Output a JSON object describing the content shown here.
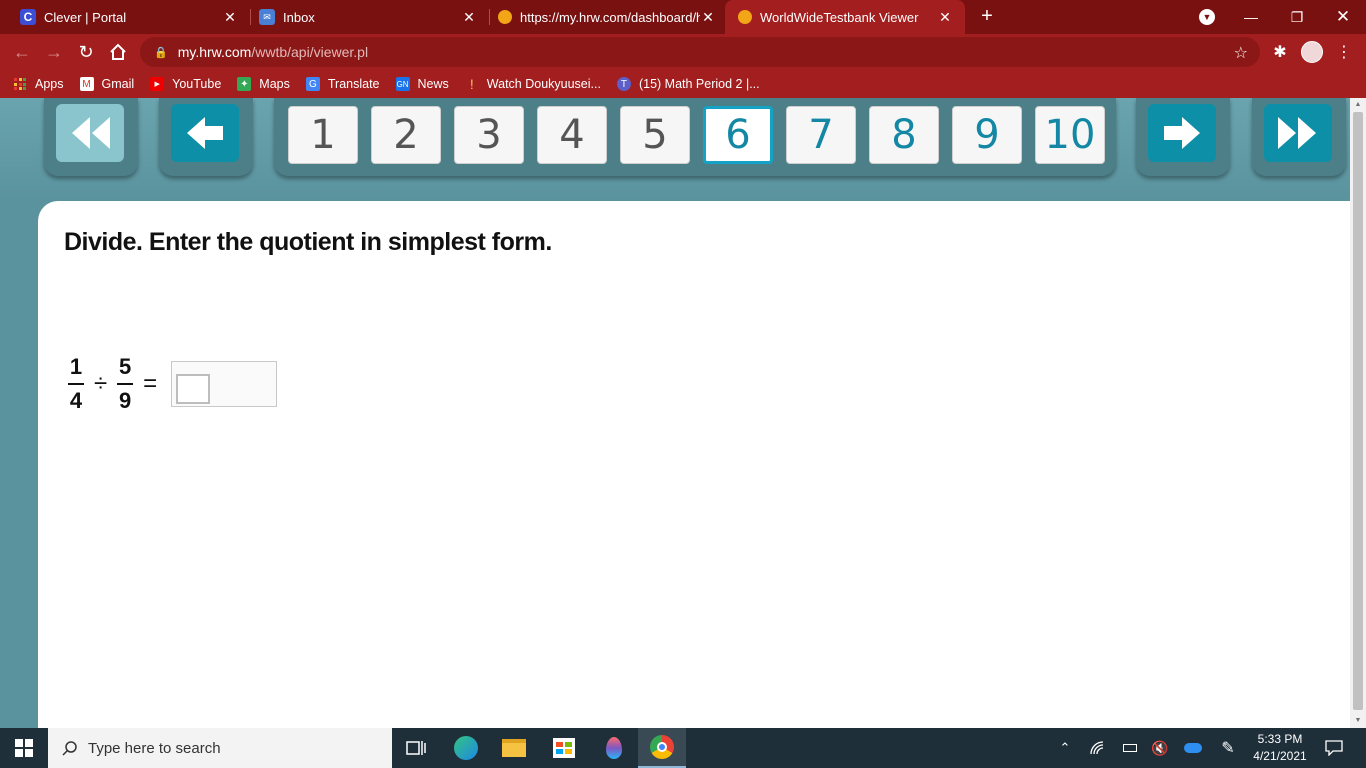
{
  "browser": {
    "tabs": [
      {
        "title": "Clever | Portal",
        "favicon": "clever-icon"
      },
      {
        "title": "Inbox",
        "favicon": "inbox-icon"
      },
      {
        "title": "https://my.hrw.com/dashboard/h",
        "favicon": "hrw-icon"
      },
      {
        "title": "WorldWideTestbank Viewer",
        "favicon": "hrw-icon",
        "active": true
      }
    ],
    "new_tab_label": "+",
    "url_host": "my.hrw.com",
    "url_path": "/wwtb/api/viewer.pl"
  },
  "bookmarks": [
    {
      "label": "Apps"
    },
    {
      "label": "Gmail"
    },
    {
      "label": "YouTube"
    },
    {
      "label": "Maps"
    },
    {
      "label": "Translate"
    },
    {
      "label": "News"
    },
    {
      "label": "Watch Doukyuusei..."
    },
    {
      "label": "(15) Math Period 2 |..."
    }
  ],
  "pager": {
    "pages": [
      "1",
      "2",
      "3",
      "4",
      "5",
      "6",
      "7",
      "8",
      "9",
      "10"
    ],
    "current": "6"
  },
  "question": {
    "prompt": "Divide. Enter the quotient in simplest form.",
    "frac1_num": "1",
    "frac1_den": "4",
    "operator": "÷",
    "frac2_num": "5",
    "frac2_den": "9",
    "equals": "="
  },
  "taskbar": {
    "search_placeholder": "Type here to search",
    "time": "5:33 PM",
    "date": "4/21/2021"
  },
  "colors": {
    "chrome_dark": "#7a1111",
    "chrome": "#a31e1e",
    "teal_bg": "#5a939e",
    "nav_blue": "#0d8fa8",
    "page_current": "#14a3c6"
  }
}
